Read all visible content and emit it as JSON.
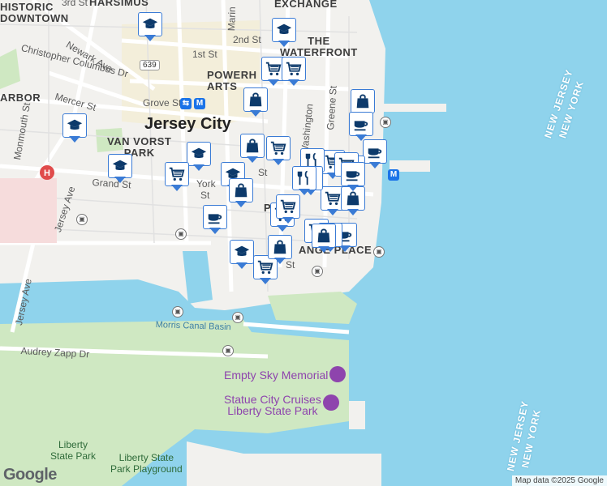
{
  "labels": {
    "historic_downtown": "HISTORIC\nDOWNTOWN",
    "harsimus": "HARSIMUS",
    "exchange": "EXCHANGE",
    "the_waterfront": "THE\nWATERFRONT",
    "powerhouse_arts": "POWERH\nARTS",
    "harbor": "ARBOR",
    "van_vorst_park": "VAN VORST\nPARK",
    "paulus_hook": "PAU",
    "exchange_place": "ANGE PLACE",
    "city": "Jersey City",
    "newark_ave": "Newark Ave",
    "columbus_dr": "Christopher Columbus Dr",
    "mercer_st": "Mercer St",
    "grand_st": "Grand St",
    "jersey_ave": "Jersey Ave",
    "jersey_ave_2": "Jersey Ave",
    "monmouth_st": "Monmouth St",
    "grove_st": "Grove St",
    "washington": "Washington",
    "greene_st": "Greene St",
    "marin": "Marin",
    "second_st": "2nd St",
    "first_st": "1st St",
    "third_st": "3rd St",
    "york": "York",
    "audrey_zapp": "Audrey Zapp Dr",
    "morris_canal": "Morris Canal Basin",
    "empty_sky": "Empty Sky Memorial",
    "statue_cruises": "Statue City Cruises\nLiberty State Park",
    "liberty_state_park": "Liberty\nState Park",
    "playground": "Liberty State\nPark Playground",
    "new_jersey_1": "NEW JERSEY",
    "new_york_1": "NEW YORK",
    "new_jersey_2": "NEW JERSEY",
    "new_york_2": "NEW YORK",
    "route": "639",
    "st_short": "St",
    "st_short_2": "St",
    "st_short_3": "St"
  },
  "branding": {
    "logo": "Google",
    "attribution": "Map data ©2025 Google"
  },
  "icons": {
    "school": "school-icon",
    "shop": "shopping-cart-icon",
    "bag": "shopping-bag-icon",
    "cafe": "coffee-cup-icon",
    "food": "restaurant-icon"
  },
  "colors": {
    "water": "#8fd3ec",
    "land": "#f2f1ee",
    "park": "#cfe8c2",
    "pin": "#3a7bd5",
    "icon": "#0d3a6b"
  },
  "pins": [
    {
      "type": "school"
    },
    {
      "type": "school"
    },
    {
      "type": "school"
    },
    {
      "type": "school"
    },
    {
      "type": "school"
    },
    {
      "type": "school"
    },
    {
      "type": "school"
    },
    {
      "type": "shop"
    },
    {
      "type": "shop"
    },
    {
      "type": "shop"
    },
    {
      "type": "shop"
    },
    {
      "type": "shop"
    },
    {
      "type": "shop"
    },
    {
      "type": "shop"
    },
    {
      "type": "shop"
    },
    {
      "type": "shop"
    },
    {
      "type": "bag"
    },
    {
      "type": "bag"
    },
    {
      "type": "bag"
    },
    {
      "type": "bag"
    },
    {
      "type": "bag"
    },
    {
      "type": "bag"
    },
    {
      "type": "cafe"
    },
    {
      "type": "cafe"
    },
    {
      "type": "cafe"
    },
    {
      "type": "cafe"
    },
    {
      "type": "cafe"
    },
    {
      "type": "food"
    },
    {
      "type": "food"
    },
    {
      "type": "food"
    },
    {
      "type": "shop"
    },
    {
      "type": "bag"
    },
    {
      "type": "cafe"
    },
    {
      "type": "shop"
    },
    {
      "type": "food"
    }
  ]
}
